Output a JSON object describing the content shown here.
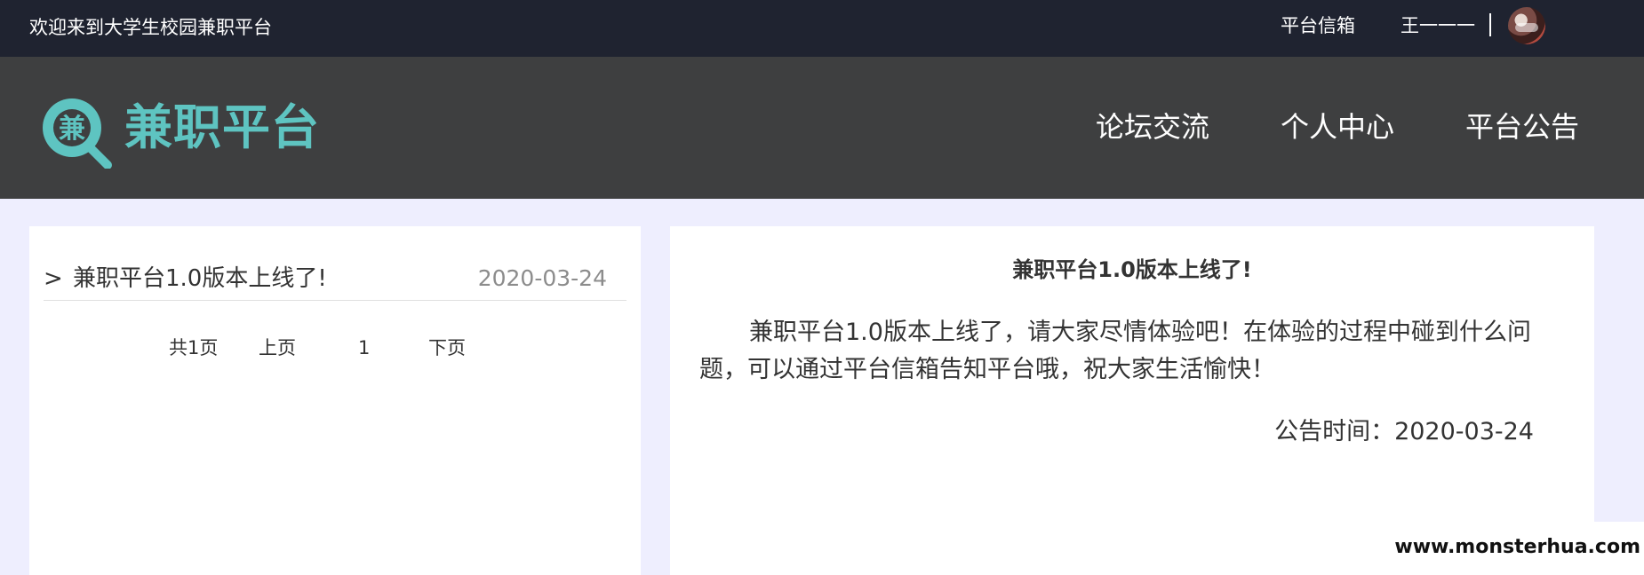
{
  "topbar": {
    "welcome": "欢迎来到大学生校园兼职平台",
    "mailbox": "平台信箱",
    "username": "王一一一",
    "avatar_icon": "user-avatar"
  },
  "header": {
    "logo_char": "兼",
    "logo_text": "兼职平台",
    "nav": {
      "forum": "论坛交流",
      "personal": "个人中心",
      "notice": "平台公告"
    }
  },
  "notice_list": {
    "items": [
      {
        "arrow": ">",
        "title": "兼职平台1.0版本上线了!",
        "date": "2020-03-24"
      }
    ],
    "pagination": {
      "total": "共1页",
      "prev": "上页",
      "current": "1",
      "next": "下页"
    }
  },
  "notice_detail": {
    "title": "兼职平台1.0版本上线了!",
    "body": "兼职平台1.0版本上线了，请大家尽情体验吧！在体验的过程中碰到什么问题，可以通过平台信箱告知平台哦，祝大家生活愉快！",
    "time": "公告时间：2020-03-24"
  },
  "watermark": "www.monsterhua.com",
  "colors": {
    "topbar_bg": "#1f2330",
    "header_bg": "#3e3f40",
    "brand": "#5ec4c1",
    "page_bg": "#eeeefe"
  }
}
